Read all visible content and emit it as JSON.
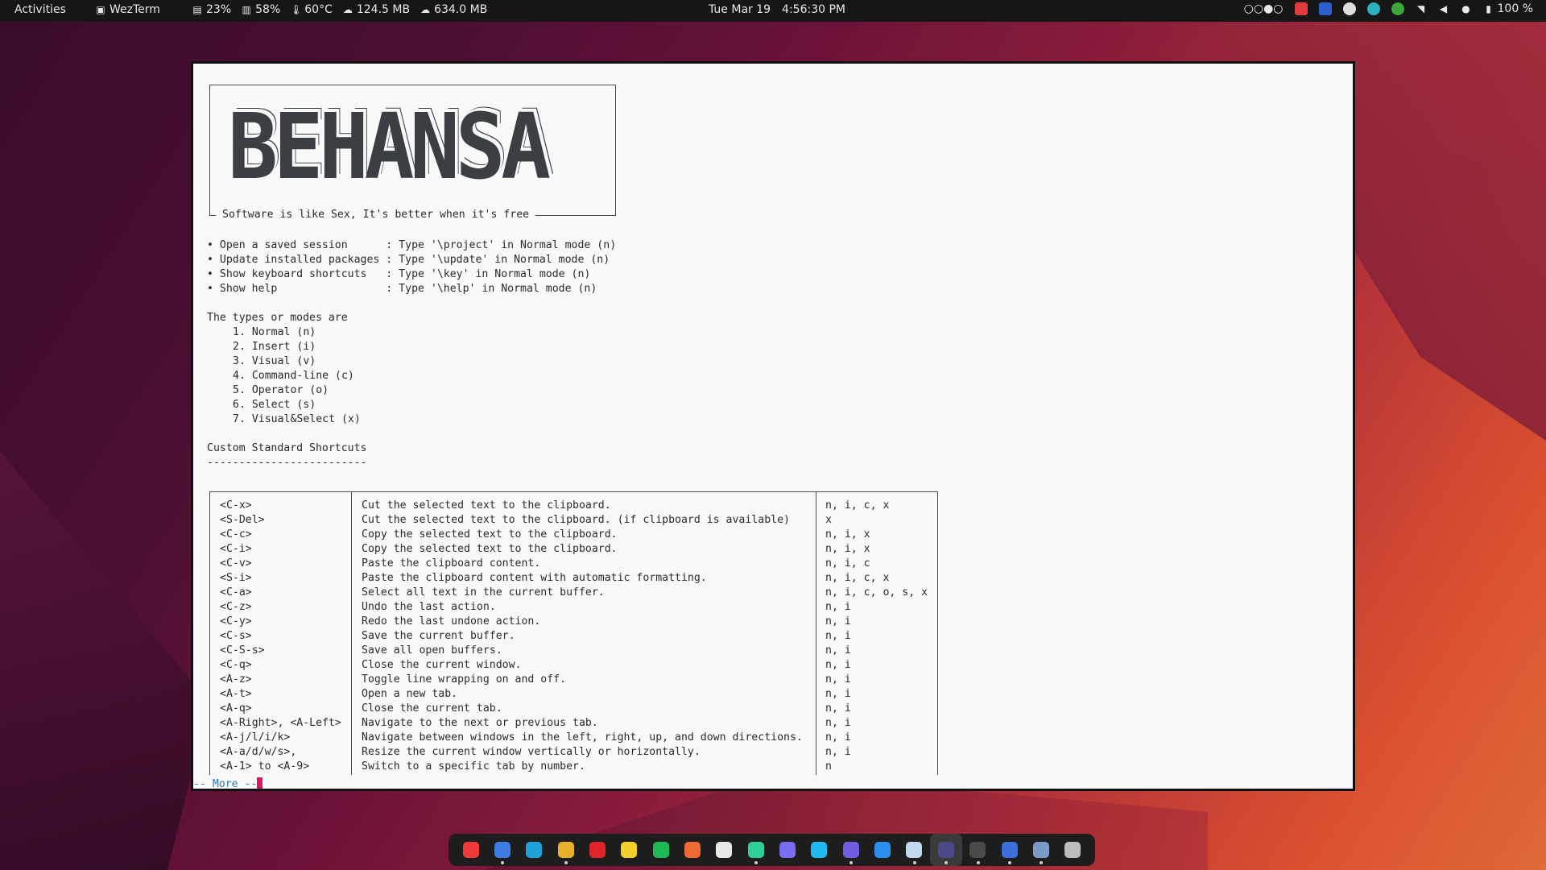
{
  "topbar": {
    "activities": "Activities",
    "app": "WezTerm",
    "stats": [
      {
        "icon": "disk-icon",
        "value": "23%"
      },
      {
        "icon": "memory-icon",
        "value": "58%"
      },
      {
        "icon": "thermometer-icon",
        "value": "60°C"
      },
      {
        "icon": "upload-icon",
        "value": "124.5 MB"
      },
      {
        "icon": "download-icon",
        "value": "634.0 MB"
      }
    ],
    "date": "Tue Mar 19",
    "time": "4:56:30 PM",
    "workspaces": "○○●○",
    "battery": "100 %"
  },
  "terminal": {
    "logo": "BEHANSA",
    "tagline": "Software is like Sex, It's better when it's free",
    "actions": [
      "• Open a saved session      : Type '\\project' in Normal mode (n)",
      "• Update installed packages : Type '\\update' in Normal mode (n)",
      "• Show keyboard shortcuts   : Type '\\key' in Normal mode (n)",
      "• Show help                 : Type '\\help' in Normal mode (n)"
    ],
    "modes_heading": "The types or modes are",
    "modes": [
      "1. Normal (n)",
      "2. Insert (i)",
      "3. Visual (v)",
      "4. Command-line (c)",
      "5. Operator (o)",
      "6. Select (s)",
      "7. Visual&Select (x)"
    ],
    "shortcuts_heading": "Custom Standard Shortcuts",
    "shortcuts_rule": "-------------------------",
    "shortcuts": [
      {
        "key": "<C-x>",
        "desc": "Cut the selected text to the clipboard.",
        "modes": "n, i, c, x"
      },
      {
        "key": "<S-Del>",
        "desc": "Cut the selected text to the clipboard. (if clipboard is available)",
        "modes": "x"
      },
      {
        "key": "<C-c>",
        "desc": "Copy the selected text to the clipboard.",
        "modes": "n, i, x"
      },
      {
        "key": "<C-i>",
        "desc": "Copy the selected text to the clipboard.",
        "modes": "n, i, x"
      },
      {
        "key": "<C-v>",
        "desc": "Paste the clipboard content.",
        "modes": "n, i, c"
      },
      {
        "key": "<S-i>",
        "desc": "Paste the clipboard content with automatic formatting.",
        "modes": "n, i, c, x"
      },
      {
        "key": "<C-a>",
        "desc": "Select all text in the current buffer.",
        "modes": "n, i, c, o, s, x"
      },
      {
        "key": "<C-z>",
        "desc": "Undo the last action.",
        "modes": "n, i"
      },
      {
        "key": "<C-y>",
        "desc": "Redo the last undone action.",
        "modes": "n, i"
      },
      {
        "key": "<C-s>",
        "desc": "Save the current buffer.",
        "modes": "n, i"
      },
      {
        "key": "<C-S-s>",
        "desc": "Save all open buffers.",
        "modes": "n, i"
      },
      {
        "key": "<C-q>",
        "desc": "Close the current window.",
        "modes": "n, i"
      },
      {
        "key": "<A-z>",
        "desc": "Toggle line wrapping on and off.",
        "modes": "n, i"
      },
      {
        "key": "<A-t>",
        "desc": "Open a new tab.",
        "modes": "n, i"
      },
      {
        "key": "<A-q>",
        "desc": "Close the current tab.",
        "modes": "n, i"
      },
      {
        "key": "<A-Right>, <A-Left>",
        "desc": "Navigate to the next or previous tab.",
        "modes": "n, i"
      },
      {
        "key": "<A-j/l/i/k>",
        "desc": "Navigate between windows in the left, right, up, and down directions.",
        "modes": "n, i"
      },
      {
        "key": "<A-a/d/w/s>,",
        "desc": "Resize the current window vertically or horizontally.",
        "modes": "n, i"
      },
      {
        "key": "<A-1> to <A-9>",
        "desc": "Switch to a specific tab by number.",
        "modes": "n"
      }
    ],
    "pager": "-- More --"
  },
  "dock": {
    "apps": [
      {
        "name": "vivaldi-icon",
        "color": "#ef3939"
      },
      {
        "name": "firefox-icon",
        "color": "#3b7de0"
      },
      {
        "name": "edge-icon",
        "color": "#1fa0d8"
      },
      {
        "name": "chrome-icon",
        "color": "#e8b02a"
      },
      {
        "name": "app-red-icon",
        "color": "#e0242a"
      },
      {
        "name": "notes-icon",
        "color": "#f2d02a"
      },
      {
        "name": "spotify-icon",
        "color": "#1db954"
      },
      {
        "name": "app-orange-icon",
        "color": "#f06a35"
      },
      {
        "name": "app-white-icon",
        "color": "#e8e8e8"
      },
      {
        "name": "clion-icon",
        "color": "#2fcf9a"
      },
      {
        "name": "goland-icon",
        "color": "#7a6cf0"
      },
      {
        "name": "webstorm-icon",
        "color": "#20b8f0"
      },
      {
        "name": "datagrip-icon",
        "color": "#6f5ee0"
      },
      {
        "name": "vscode-icon",
        "color": "#2a8ff0"
      },
      {
        "name": "settings-app-icon",
        "color": "#c0d8f0"
      },
      {
        "name": "wezterm-icon",
        "color": "#4a4a8a"
      },
      {
        "name": "terminal-icon",
        "color": "#4a4a4a"
      },
      {
        "name": "app-blue-icon",
        "color": "#3b6ed8"
      },
      {
        "name": "files-icon",
        "color": "#7a9ac8"
      },
      {
        "name": "app-grid-icon",
        "color": "#bbbbbb"
      }
    ]
  }
}
